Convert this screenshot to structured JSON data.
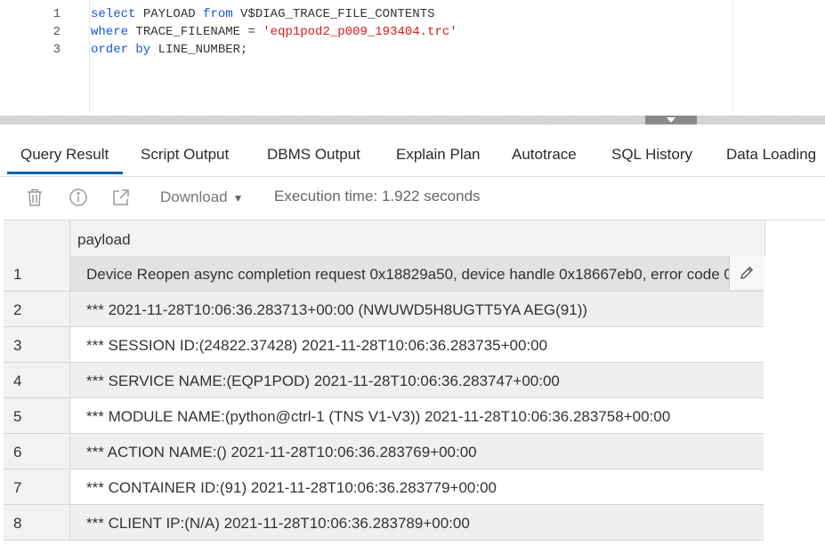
{
  "editor": {
    "line_numbers": [
      "1",
      "2",
      "3"
    ],
    "line1": {
      "kw1": "select",
      "mid": " PAYLOAD ",
      "kw2": "from",
      "rest": " V$DIAG_TRACE_FILE_CONTENTS"
    },
    "line2": {
      "kw": "where",
      "mid": " TRACE_FILENAME = ",
      "str": "'eqp1pod2_p009_193404.trc'"
    },
    "line3": {
      "kw": "order by",
      "rest": " LINE_NUMBER;"
    }
  },
  "tabs": [
    "Query Result",
    "Script Output",
    "DBMS Output",
    "Explain Plan",
    "Autotrace",
    "SQL History",
    "Data Loading"
  ],
  "active_tab": "Query Result",
  "toolbar": {
    "icons": [
      "trash-icon",
      "info-icon",
      "open-external-icon"
    ],
    "download_label": "Download",
    "execution_time": "Execution time: 1.922 seconds"
  },
  "grid": {
    "column": "payload",
    "rows": [
      {
        "n": "1",
        "payload": "Device Reopen async completion request 0x18829a50, device handle 0x18667eb0, error code 0"
      },
      {
        "n": "2",
        "payload": "*** 2021-11-28T10:06:36.283713+00:00 (NWUWD5H8UGTT5YA  AEG(91))"
      },
      {
        "n": "3",
        "payload": "*** SESSION ID:(24822.37428) 2021-11-28T10:06:36.283735+00:00"
      },
      {
        "n": "4",
        "payload": "*** SERVICE NAME:(EQP1POD) 2021-11-28T10:06:36.283747+00:00"
      },
      {
        "n": "5",
        "payload": "*** MODULE NAME:(python@ctrl-1 (TNS V1-V3)) 2021-11-28T10:06:36.283758+00:00"
      },
      {
        "n": "6",
        "payload": "*** ACTION NAME:() 2021-11-28T10:06:36.283769+00:00"
      },
      {
        "n": "7",
        "payload": "*** CONTAINER ID:(91) 2021-11-28T10:06:36.283779+00:00"
      },
      {
        "n": "8",
        "payload": "*** CLIENT IP:(N/A) 2021-11-28T10:06:36.283789+00:00"
      }
    ]
  },
  "colors": {
    "accent": "#0a62b3",
    "keyword": "#1a55d6",
    "string": "#d81b1b"
  }
}
